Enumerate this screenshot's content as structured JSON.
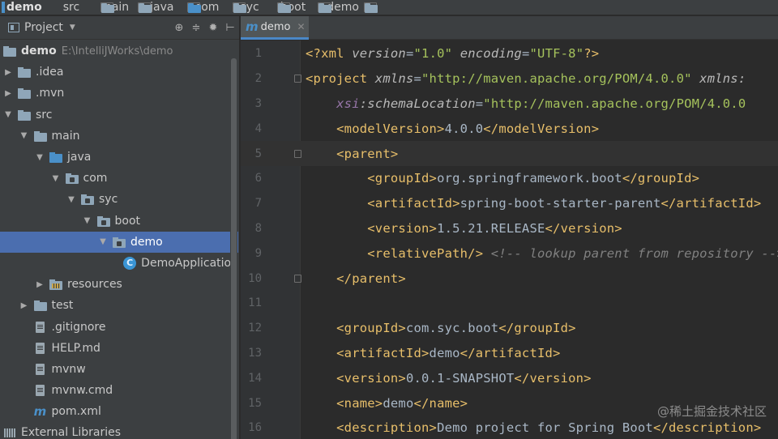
{
  "breadcrumbs": [
    "demo",
    "src",
    "main",
    "java",
    "com",
    "syc",
    "boot",
    "demo"
  ],
  "project_panel": {
    "title": "Project",
    "tree": [
      {
        "label": "demo",
        "path": "E:\\IntelliJWorks\\demo",
        "indent": 0,
        "arrow": "",
        "icon": "module-folder-icon",
        "bold": true
      },
      {
        "label": ".idea",
        "indent": 0,
        "arrow": "▶",
        "icon": "folder-icon"
      },
      {
        "label": ".mvn",
        "indent": 0,
        "arrow": "▶",
        "icon": "folder-icon"
      },
      {
        "label": "src",
        "indent": 0,
        "arrow": "▼",
        "icon": "folder-icon"
      },
      {
        "label": "main",
        "indent": 1,
        "arrow": "▼",
        "icon": "folder-icon"
      },
      {
        "label": "java",
        "indent": 2,
        "arrow": "▼",
        "icon": "source-folder-icon"
      },
      {
        "label": "com",
        "indent": 3,
        "arrow": "▼",
        "icon": "package-icon"
      },
      {
        "label": "syc",
        "indent": 4,
        "arrow": "▼",
        "icon": "package-icon"
      },
      {
        "label": "boot",
        "indent": 5,
        "arrow": "▼",
        "icon": "package-icon"
      },
      {
        "label": "demo",
        "indent": 6,
        "arrow": "▼",
        "icon": "package-icon",
        "selected": true
      },
      {
        "label": "DemoApplication",
        "indent": 7,
        "arrow": "",
        "icon": "class-icon"
      },
      {
        "label": "resources",
        "indent": 2,
        "arrow": "▶",
        "icon": "resources-folder-icon"
      },
      {
        "label": "test",
        "indent": 1,
        "arrow": "▶",
        "icon": "folder-icon"
      },
      {
        "label": ".gitignore",
        "indent": 1,
        "arrow": "",
        "icon": "file-icon"
      },
      {
        "label": "HELP.md",
        "indent": 1,
        "arrow": "",
        "icon": "markdown-file-icon"
      },
      {
        "label": "mvnw",
        "indent": 1,
        "arrow": "",
        "icon": "file-icon"
      },
      {
        "label": "mvnw.cmd",
        "indent": 1,
        "arrow": "",
        "icon": "file-icon"
      },
      {
        "label": "pom.xml",
        "indent": 1,
        "arrow": "",
        "icon": "maven-icon"
      },
      {
        "label": "External Libraries",
        "indent": 0,
        "arrow": "",
        "icon": "library-icon"
      }
    ]
  },
  "editor": {
    "tab": {
      "label": "demo",
      "icon": "maven-icon"
    },
    "current_line": 5,
    "lines": [
      {
        "n": "1",
        "tokens": [
          [
            "pi",
            "<?"
          ],
          [
            "tag",
            "xml "
          ],
          [
            "attr-i",
            "version"
          ],
          [
            "txt",
            "="
          ],
          [
            "str",
            "\"1.0\" "
          ],
          [
            "attr-i",
            "encoding"
          ],
          [
            "txt",
            "="
          ],
          [
            "str",
            "\"UTF-8\""
          ],
          [
            "pi",
            "?>"
          ]
        ]
      },
      {
        "n": "2",
        "fold": true,
        "tokens": [
          [
            "tag",
            "<project "
          ],
          [
            "attr-i",
            "xmlns"
          ],
          [
            "txt",
            "="
          ],
          [
            "str",
            "\"http://maven.apache.org/POM/4.0.0\" "
          ],
          [
            "attr-i",
            "xmlns:"
          ]
        ]
      },
      {
        "n": "3",
        "tokens": [
          [
            "txt",
            "    "
          ],
          [
            "ns",
            "xsi"
          ],
          [
            "attr-i",
            ":schemaLocation"
          ],
          [
            "txt",
            "="
          ],
          [
            "str",
            "\"http://maven.apache.org/POM/4.0.0"
          ]
        ]
      },
      {
        "n": "4",
        "tokens": [
          [
            "txt",
            "    "
          ],
          [
            "tag",
            "<modelVersion>"
          ],
          [
            "txt",
            "4.0.0"
          ],
          [
            "tag",
            "</modelVersion>"
          ]
        ]
      },
      {
        "n": "5",
        "fold": true,
        "tokens": [
          [
            "txt",
            "    "
          ],
          [
            "tag",
            "<parent>"
          ]
        ]
      },
      {
        "n": "6",
        "tokens": [
          [
            "txt",
            "        "
          ],
          [
            "tag",
            "<groupId>"
          ],
          [
            "txt",
            "org.springframework.boot"
          ],
          [
            "tag",
            "</groupId>"
          ]
        ]
      },
      {
        "n": "7",
        "tokens": [
          [
            "txt",
            "        "
          ],
          [
            "tag",
            "<artifactId>"
          ],
          [
            "txt",
            "spring-boot-starter-parent"
          ],
          [
            "tag",
            "</artifactId>"
          ]
        ]
      },
      {
        "n": "8",
        "tokens": [
          [
            "txt",
            "        "
          ],
          [
            "tag",
            "<version>"
          ],
          [
            "txt",
            "1.5.21.RELEASE"
          ],
          [
            "tag",
            "</version>"
          ]
        ]
      },
      {
        "n": "9",
        "tokens": [
          [
            "txt",
            "        "
          ],
          [
            "tag",
            "<relativePath/>"
          ],
          [
            "txt",
            " "
          ],
          [
            "com",
            "<!-- lookup parent from repository -->"
          ]
        ]
      },
      {
        "n": "10",
        "fold": true,
        "tokens": [
          [
            "txt",
            "    "
          ],
          [
            "tag",
            "</parent>"
          ]
        ]
      },
      {
        "n": "11",
        "tokens": []
      },
      {
        "n": "12",
        "tokens": [
          [
            "txt",
            "    "
          ],
          [
            "tag",
            "<groupId>"
          ],
          [
            "txt",
            "com.syc.boot"
          ],
          [
            "tag",
            "</groupId>"
          ]
        ]
      },
      {
        "n": "13",
        "tokens": [
          [
            "txt",
            "    "
          ],
          [
            "tag",
            "<artifactId>"
          ],
          [
            "txt",
            "demo"
          ],
          [
            "tag",
            "</artifactId>"
          ]
        ]
      },
      {
        "n": "14",
        "tokens": [
          [
            "txt",
            "    "
          ],
          [
            "tag",
            "<version>"
          ],
          [
            "txt",
            "0.0.1-SNAPSHOT"
          ],
          [
            "tag",
            "</version>"
          ]
        ]
      },
      {
        "n": "15",
        "tokens": [
          [
            "txt",
            "    "
          ],
          [
            "tag",
            "<name>"
          ],
          [
            "txt",
            "demo"
          ],
          [
            "tag",
            "</name>"
          ]
        ]
      },
      {
        "n": "16",
        "tokens": [
          [
            "txt",
            "    "
          ],
          [
            "tag",
            "<description>"
          ],
          [
            "txt",
            "Demo project for Spring Boot"
          ],
          [
            "tag",
            "</description>"
          ]
        ]
      }
    ]
  },
  "watermark": "@稀土掘金技术社区"
}
